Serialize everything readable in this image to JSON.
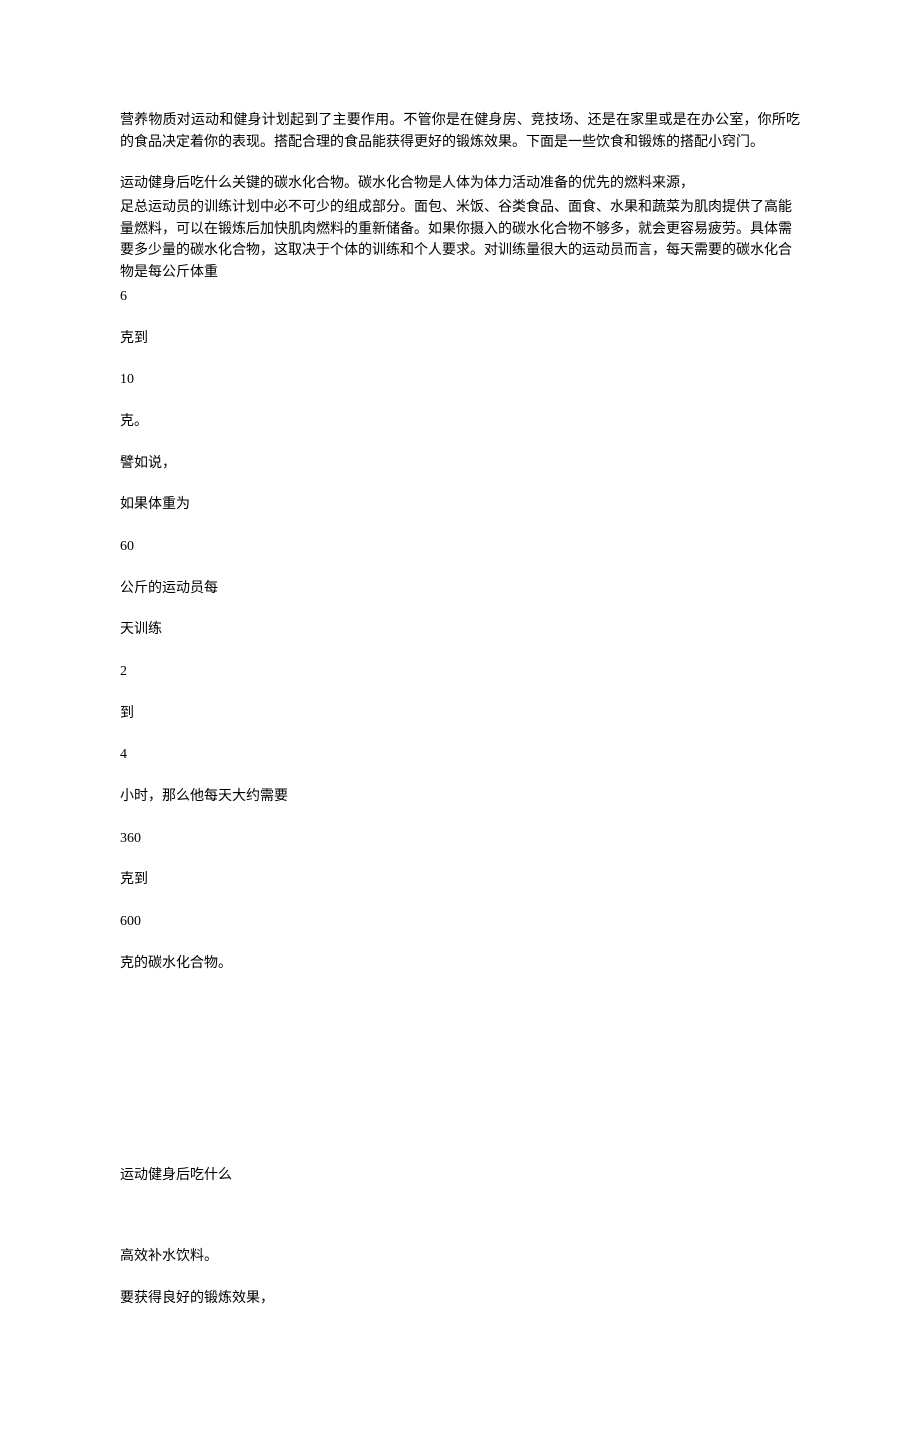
{
  "p1": "营养物质对运动和健身计划起到了主要作用。不管你是在健身房、竞技场、还是在家里或是在办公室，你所吃的食品决定着你的表现。搭配合理的食品能获得更好的锻炼效果。下面是一些饮食和锻炼的搭配小窍门。",
  "p2a": "运动健身后吃什么关键的碳水化合物。碳水化合物是人体为体力活动准备的优先的燃料来源，",
  "p2b": "足总运动员的训练计划中必不可少的组成部分。面包、米饭、谷类食品、面食、水果和蔬菜为肌肉提供了高能量燃料，可以在锻炼后加快肌肉燃料的重新储备。如果你摄入的碳水化合物不够多，就会更容易疲劳。具体需要多少量的碳水化合物，这取决于个体的训练和个人要求。对训练量很大的运动员而言，每天需要的碳水化合物是每公斤体重",
  "l": {
    "l1": "6",
    "l2": "克到",
    "l3": "10",
    "l4": "克。",
    "l5": "譬如说，",
    "l6": "如果体重为",
    "l7": "60",
    "l8": "公斤的运动员每",
    "l9": "天训练",
    "l10": "2",
    "l11": "到",
    "l12": "4",
    "l13": "小时，那么他每天大约需要",
    "l14": "360",
    "l15": "克到",
    "l16": "600",
    "l17": "克的碳水化合物。"
  },
  "h1": "运动健身后吃什么",
  "h2": "高效补水饮料。",
  "h3": "要获得良好的锻炼效果，"
}
